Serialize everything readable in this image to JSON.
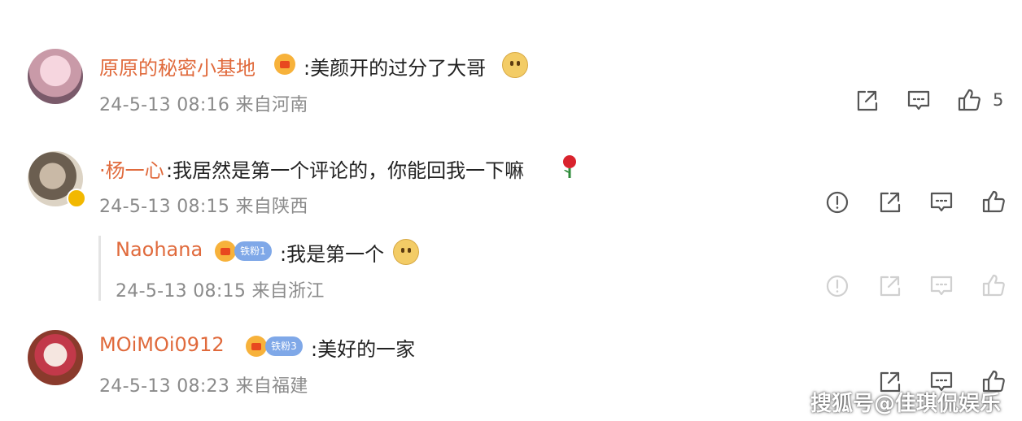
{
  "comments": [
    {
      "username": "原原的秘密小基地",
      "text": ":美颜开的过分了大哥",
      "meta": "24-5-13 08:16 来自河南",
      "like_count": "5"
    },
    {
      "username": "·杨一心",
      "text": ":我居然是第一个评论的，你能回我一下嘛",
      "meta": "24-5-13 08:15 来自陕西",
      "reply": {
        "username": "Naohana",
        "badge": "铁粉1",
        "text": ":我是第一个",
        "meta": "24-5-13 08:15 来自浙江"
      }
    },
    {
      "username": "MOiMOi0912",
      "badge": "铁粉3",
      "text": ":美好的一家",
      "meta": "24-5-13 08:23 来自福建"
    }
  ],
  "watermark": "搜狐号@佳琪侃娱乐",
  "colors": {
    "username": "#e06a3c",
    "meta": "#8a8a8a",
    "icon": "#555555",
    "icon_faded": "#d0d0d0"
  },
  "icons": [
    "share-icon",
    "comment-icon",
    "like-icon",
    "report-icon",
    "crown-icon",
    "rose-icon",
    "cat-emoji-icon"
  ]
}
